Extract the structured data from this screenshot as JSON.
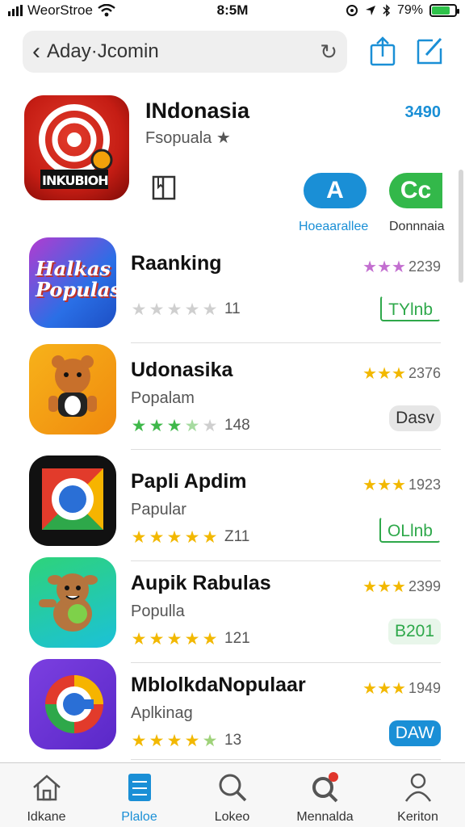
{
  "status": {
    "carrier": "WeorStroe",
    "time": "8:5M",
    "battery": "79%",
    "battery_level": 0.79
  },
  "browser": {
    "url": "Aday·Jcomin"
  },
  "featured": {
    "title": "INdonasia",
    "subtitle": "Fsopuala",
    "rating": "3490",
    "icon_text": "INKUBIOH",
    "buttons": [
      {
        "glyph": "A",
        "label": "Hoeaarallee",
        "color": "#1a8fd6"
      },
      {
        "glyph": "Cc",
        "label": "Donnnaia",
        "color": "#33b84a"
      }
    ]
  },
  "apps": [
    {
      "title": "Rаanking",
      "subtitle": "",
      "icon_text": "Halkas Populas",
      "stars_value": 0,
      "stars_text": "11",
      "rating": "★★★",
      "rating_color": "#c36fd0",
      "rating_count": "2239",
      "button": "TYlnb",
      "button_style": "outline-green"
    },
    {
      "title": "Udonasika",
      "subtitle": "Popalam",
      "icon_text": "",
      "stars_value": 3.5,
      "stars_text": "148",
      "rating": "★★★",
      "rating_color": "#f2b800",
      "rating_count": "2376",
      "button": "Dasv",
      "button_style": "gray"
    },
    {
      "title": "Papli Apdim",
      "subtitle": "Papular",
      "icon_text": "",
      "stars_value": 5,
      "stars_text": "Z11",
      "rating": "★★★",
      "rating_color": "#f2b800",
      "rating_count": "1923",
      "button": "OLlnb",
      "button_style": "outline-green"
    },
    {
      "title": "Aupik Rabulas",
      "subtitle": "Populla",
      "icon_text": "",
      "stars_value": 5,
      "stars_text": "121",
      "rating": "★★★",
      "rating_color": "#f2b800",
      "rating_count": "2399",
      "button": "B201",
      "button_style": "pale-green"
    },
    {
      "title": "MblolkdaNopulaar",
      "subtitle": "Aplkinag",
      "icon_text": "",
      "stars_value": 4.5,
      "stars_text": "13",
      "rating": "★★★",
      "rating_color": "#f2b800",
      "rating_count": "1949",
      "button": "DAW",
      "button_style": "blue"
    }
  ],
  "tabs": [
    {
      "label": "Idkane",
      "icon": "home-icon"
    },
    {
      "label": "Plaloe",
      "icon": "apps-icon"
    },
    {
      "label": "Lokeo",
      "icon": "search-icon"
    },
    {
      "label": "Mennalda",
      "icon": "search-badge-icon"
    },
    {
      "label": "Keriton",
      "icon": "person-icon"
    }
  ]
}
